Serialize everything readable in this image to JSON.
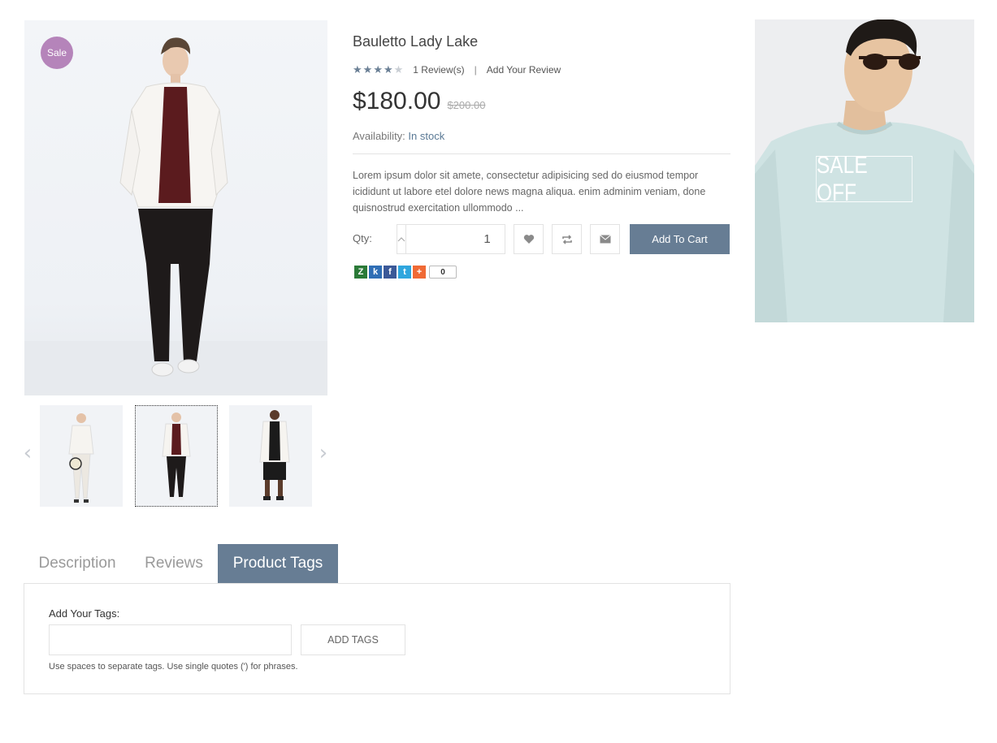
{
  "product": {
    "sale_badge": "Sale",
    "title": "Bauletto Lady Lake",
    "rating": 4,
    "rating_max": 5,
    "reviews_link": "1 Review(s)",
    "review_separator": "|",
    "add_review_link": "Add Your Review",
    "price": "$180.00",
    "old_price": "$200.00",
    "availability_label": "Availability:",
    "availability_value": "In stock",
    "description": "Lorem ipsum dolor sit amete, consectetur adipisicing sed do eiusmod tempor icididunt ut labore etel dolore news magna aliqua. enim adminim veniam, done quisnostrud exercitation ullommodo ..."
  },
  "purchase": {
    "qty_label": "Qty:",
    "qty_value": "1",
    "add_to_cart": "Add To Cart",
    "icons": [
      "chevron-up-icon",
      "chevron-down-icon",
      "heart-icon",
      "compare-icon",
      "email-icon"
    ]
  },
  "share": {
    "buttons": [
      "Z",
      "k",
      "f",
      "t",
      "+"
    ],
    "count": "0"
  },
  "banner": {
    "label": "SALE OFF"
  },
  "tabs": [
    {
      "label": "Description"
    },
    {
      "label": "Reviews"
    },
    {
      "label": "Product Tags"
    }
  ],
  "tags_panel": {
    "label": "Add Your Tags:",
    "input_value": "",
    "button": "ADD TAGS",
    "note": "Use spaces to separate tags. Use single quotes (') for phrases."
  },
  "colors": {
    "accent": "#677d94",
    "sale_badge": "#b584ba",
    "stock": "#5a7995"
  }
}
